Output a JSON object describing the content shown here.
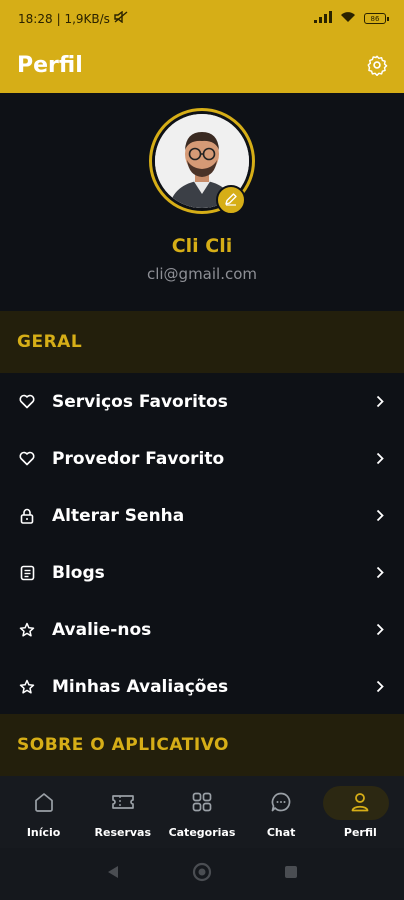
{
  "status_bar": {
    "time": "18:28",
    "network_speed": "| 1,9KB/s",
    "battery": "86"
  },
  "app_bar": {
    "title": "Perfil",
    "settings_icon": "gear-icon"
  },
  "profile": {
    "name": "Cli Cli",
    "email": "cli@gmail.com"
  },
  "sections": {
    "general_title": "GERAL",
    "about_title": "SOBRE O APLICATIVO"
  },
  "menu": {
    "items": [
      {
        "label": "Serviços Favoritos",
        "icon": "heart-icon"
      },
      {
        "label": "Provedor Favorito",
        "icon": "heart-icon"
      },
      {
        "label": "Alterar Senha",
        "icon": "lock-icon"
      },
      {
        "label": "Blogs",
        "icon": "blog-icon"
      },
      {
        "label": "Avalie-nos",
        "icon": "star-icon"
      },
      {
        "label": "Minhas Avaliações",
        "icon": "star-icon"
      }
    ]
  },
  "bottom_nav": {
    "items": [
      {
        "label": "Início",
        "icon": "home-icon"
      },
      {
        "label": "Reservas",
        "icon": "ticket-icon"
      },
      {
        "label": "Categorias",
        "icon": "grid-icon"
      },
      {
        "label": "Chat",
        "icon": "chat-icon"
      },
      {
        "label": "Perfil",
        "icon": "person-icon",
        "active": true
      }
    ]
  },
  "colors": {
    "accent": "#d6ae17",
    "background": "#0e1116",
    "section_bg": "#231f0c",
    "muted_text": "#8d8f95"
  }
}
